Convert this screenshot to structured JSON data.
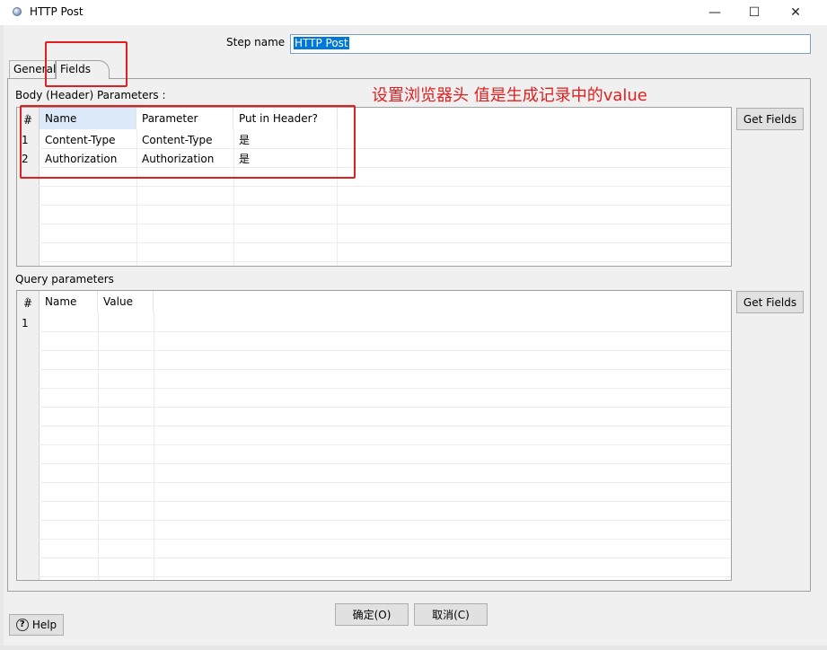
{
  "window": {
    "title": "HTTP Post",
    "minimize_glyph": "—",
    "maximize_glyph": "☐",
    "close_glyph": "✕"
  },
  "step_name": {
    "label": "Step name",
    "value": "HTTP Post"
  },
  "tabs": [
    {
      "label": "General"
    },
    {
      "label": "Fields"
    }
  ],
  "body_params": {
    "label": "Body (Header) Parameters :",
    "columns": [
      "#",
      "Name",
      "Parameter",
      "Put in Header?"
    ],
    "rows": [
      {
        "num": "1",
        "name": "Content-Type",
        "parameter": "Content-Type",
        "put_in_header": "是"
      },
      {
        "num": "2",
        "name": "Authorization",
        "parameter": "Authorization",
        "put_in_header": "是"
      }
    ],
    "get_fields_label": "Get Fields"
  },
  "query_params": {
    "label": "Query parameters",
    "columns": [
      "#",
      "Name",
      "Value"
    ],
    "rows": [
      {
        "num": "1",
        "name": "",
        "value": ""
      }
    ],
    "get_fields_label": "Get Fields"
  },
  "annotation": {
    "text": "设置浏览器头 值是生成记录中的value",
    "color": "#e02020"
  },
  "footer": {
    "ok_label": "确定(O)",
    "cancel_label": "取消(C)",
    "help_label": "Help"
  },
  "colors": {
    "selection": "#0078d7",
    "header_selected": "#dbe9f8"
  }
}
